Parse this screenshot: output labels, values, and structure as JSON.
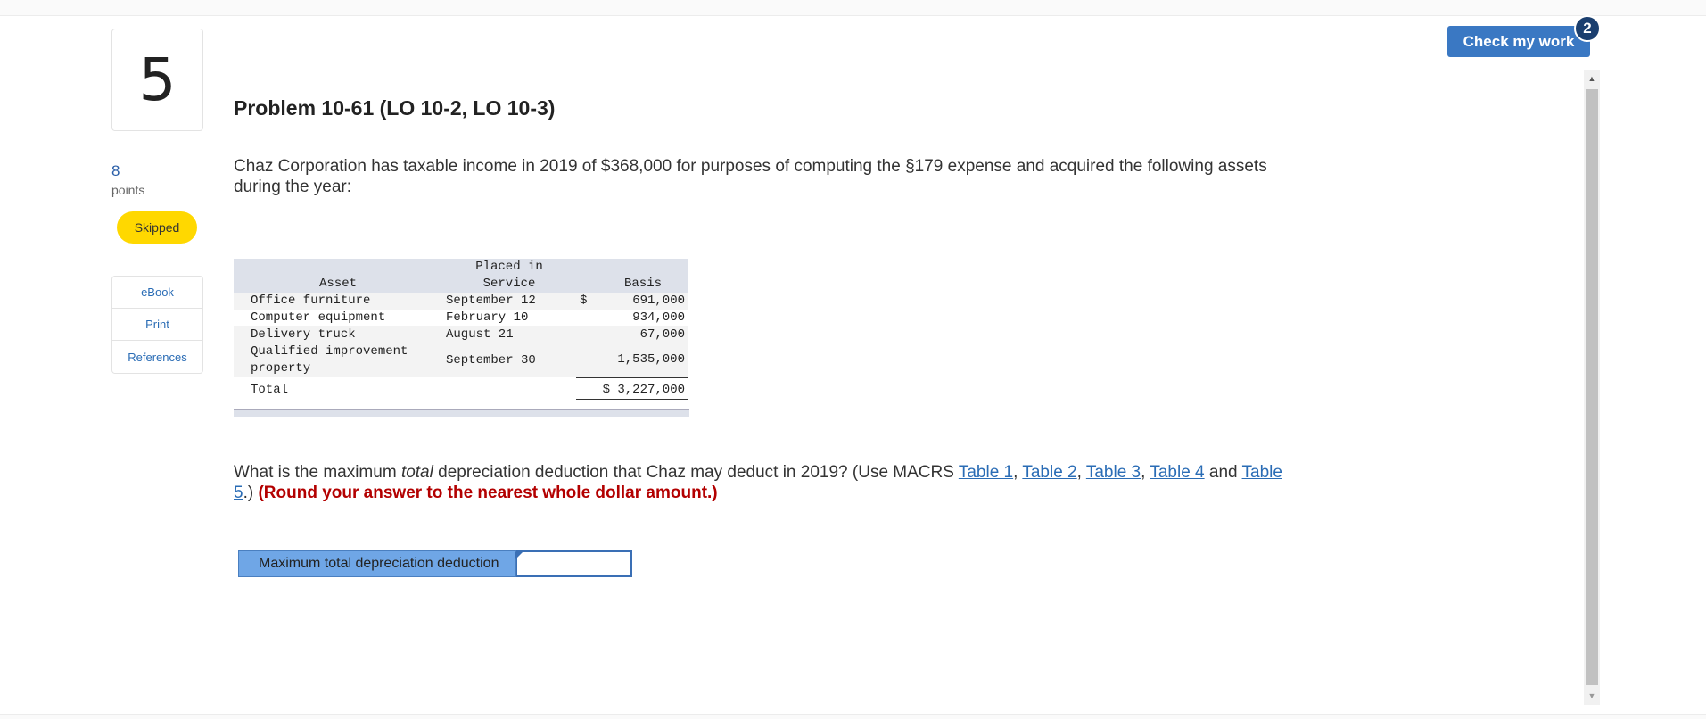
{
  "question": {
    "number": "5",
    "points_value": "8",
    "points_label": "points",
    "status": "Skipped"
  },
  "side_links": [
    "eBook",
    "Print",
    "References"
  ],
  "problem": {
    "title": "Problem 10-61 (LO 10-2, LO 10-3)",
    "intro": "Chaz Corporation has taxable income in 2019 of $368,000 for purposes of computing the §179 expense and acquired the following assets during the year:"
  },
  "asset_table": {
    "headers": {
      "asset": "Asset",
      "placed_line1": "Placed in",
      "placed_line2": "Service",
      "basis": "Basis"
    },
    "rows": [
      {
        "asset": "Office furniture",
        "date": "September 12",
        "dollar": "$",
        "basis": "691,000"
      },
      {
        "asset": "Computer equipment",
        "date": "February 10",
        "dollar": "",
        "basis": "934,000"
      },
      {
        "asset": "Delivery truck",
        "date": "August 21",
        "dollar": "",
        "basis": "67,000"
      },
      {
        "asset": "Qualified improvement property",
        "date": "September 30",
        "dollar": "",
        "basis": "1,535,000"
      }
    ],
    "total": {
      "label": "Total",
      "value": "$ 3,227,000"
    }
  },
  "question_text": {
    "part1": "What is the maximum ",
    "emph": "total",
    "part2": " depreciation deduction that Chaz may deduct in 2019? (Use MACRS ",
    "links": [
      "Table 1",
      "Table 2",
      "Table 3",
      "Table 4",
      "Table 5"
    ],
    "sep_comma": ", ",
    "sep_and": " and ",
    "after_links": ".) ",
    "instruction": "(Round your answer to the nearest whole dollar amount.)"
  },
  "answer": {
    "label": "Maximum total depreciation deduction",
    "value": ""
  },
  "header": {
    "check_button": "Check my work",
    "badge_count": "2"
  },
  "colors": {
    "accent": "#3a78c3",
    "badge": "#1b3f6f",
    "skipped": "#ffd800",
    "link": "#2a6cb5",
    "instruction_red": "#b30000",
    "answer_label_bg": "#6fa6e6"
  }
}
